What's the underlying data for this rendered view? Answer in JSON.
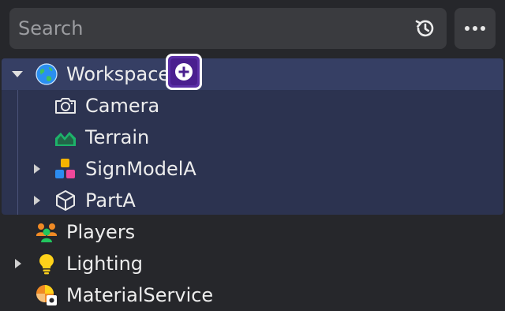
{
  "search": {
    "placeholder": "Search"
  },
  "toolbar": {
    "history_icon": "history-icon",
    "more_icon": "more-options-icon"
  },
  "tree": {
    "workspace": {
      "label": "Workspace",
      "icon": "globe-icon",
      "expanded": true
    },
    "workspace_children": [
      {
        "label": "Camera",
        "icon": "camera-icon",
        "expandable": false
      },
      {
        "label": "Terrain",
        "icon": "terrain-icon",
        "expandable": false
      },
      {
        "label": "SignModelA",
        "icon": "model-icon",
        "expandable": true
      },
      {
        "label": "PartA",
        "icon": "part-icon",
        "expandable": true
      }
    ],
    "top_level": [
      {
        "label": "Players",
        "icon": "players-icon",
        "expandable": false
      },
      {
        "label": "Lighting",
        "icon": "lightbulb-icon",
        "expandable": true
      },
      {
        "label": "MaterialService",
        "icon": "material-service-icon",
        "expandable": false
      }
    ]
  },
  "colors": {
    "background": "#26272b",
    "selection": "#363f64",
    "add_button": "#5a2ea6"
  }
}
